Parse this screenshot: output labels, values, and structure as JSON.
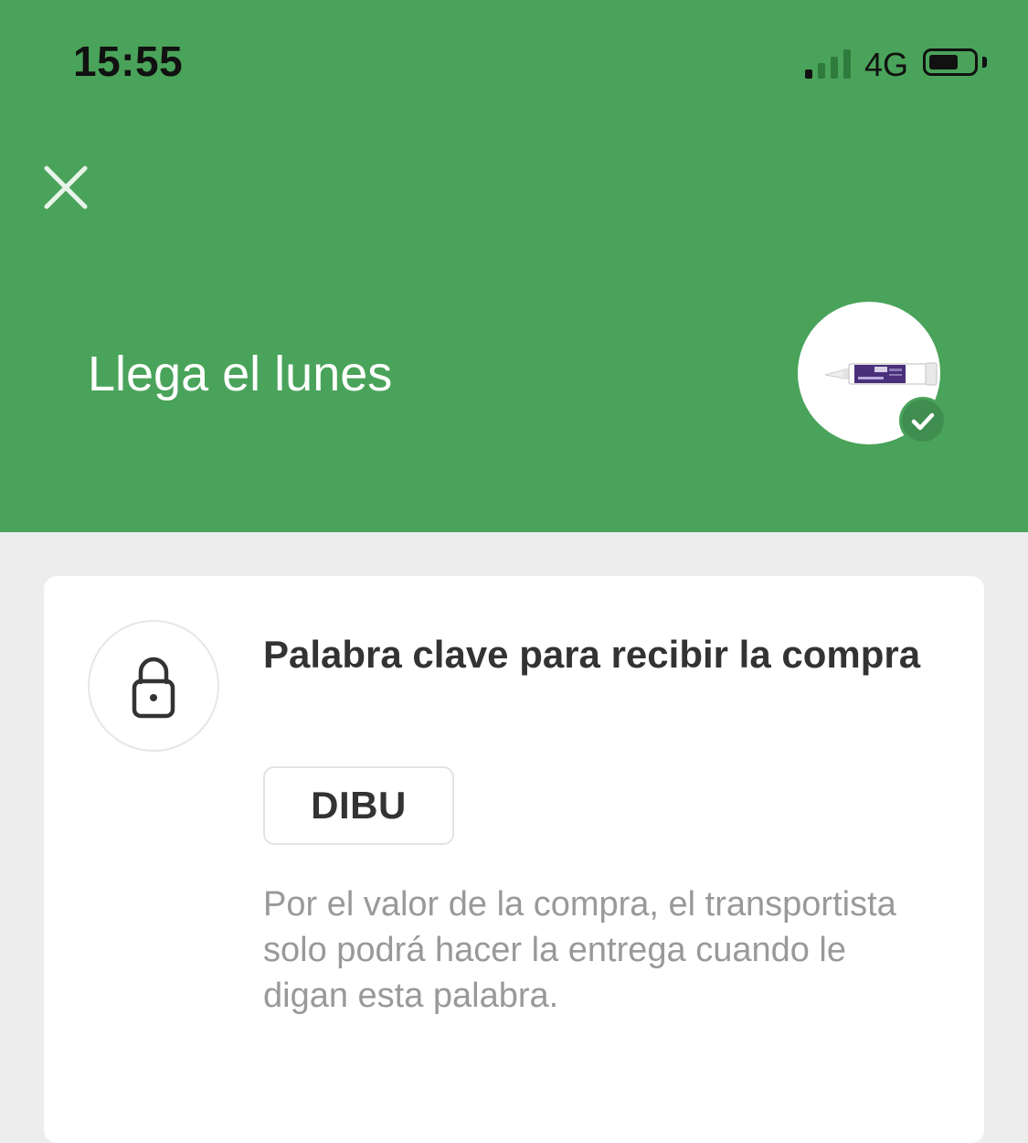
{
  "status_bar": {
    "time": "15:55",
    "network": "4G"
  },
  "header": {
    "headline": "Llega el lunes",
    "background_color": "#4aa35a"
  },
  "icons": {
    "close": "close-icon",
    "product": "product-thumbnail",
    "check": "check-icon",
    "lock": "lock-icon"
  },
  "card": {
    "title": "Palabra clave para recibir la compra",
    "keyword": "DIBU",
    "description": "Por el valor de la compra, el transportista solo podrá hacer la entrega cuando le digan esta palabra."
  }
}
